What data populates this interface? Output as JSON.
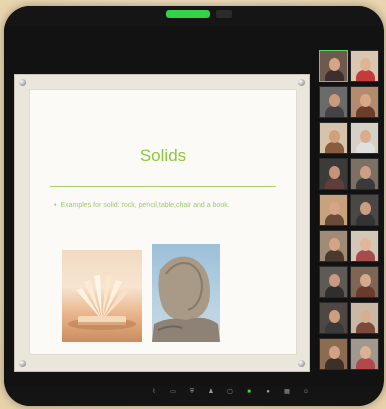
{
  "slide": {
    "title": "Solids",
    "bullet": "Examples for solid: rock, pencil,table,chair and a book."
  },
  "images": {
    "book": "book-photo",
    "rock": "rock-photo"
  },
  "colors": {
    "accent": "#8dc63f",
    "recording": "#33d24b"
  },
  "top_bar": {
    "recording_label": "",
    "view_label": ""
  },
  "participants": [
    {
      "bg": "#6d5a4d",
      "skin": "#d6a487",
      "shirt": "#3e2f2f",
      "active": true
    },
    {
      "bg": "#d9c7b2",
      "skin": "#e0b493",
      "shirt": "#c43b3b",
      "active": false
    },
    {
      "bg": "#6b6b6b",
      "skin": "#c99a7c",
      "shirt": "#444",
      "active": false
    },
    {
      "bg": "#b28c6c",
      "skin": "#d8a889",
      "shirt": "#6b3d2b",
      "active": false
    },
    {
      "bg": "#d7c2ac",
      "skin": "#d1a07f",
      "shirt": "#8b5b3e",
      "active": false
    },
    {
      "bg": "#d6d0c6",
      "skin": "#d8ad8f",
      "shirt": "#e0e0e0",
      "active": false
    },
    {
      "bg": "#3d3b3a",
      "skin": "#c6927a",
      "shirt": "#5f3d3b",
      "active": false
    },
    {
      "bg": "#7c6f64",
      "skin": "#cf9f83",
      "shirt": "#3a3a3a",
      "active": false
    },
    {
      "bg": "#c8a27c",
      "skin": "#d6a487",
      "shirt": "#6a4b3a",
      "active": false
    },
    {
      "bg": "#4a4745",
      "skin": "#cc9d82",
      "shirt": "#333",
      "active": false
    },
    {
      "bg": "#9f8b76",
      "skin": "#d4a486",
      "shirt": "#4a3a2e",
      "active": false
    },
    {
      "bg": "#d3c7b8",
      "skin": "#e1b79a",
      "shirt": "#a74c4c",
      "active": false
    },
    {
      "bg": "#5f5a55",
      "skin": "#c79a81",
      "shirt": "#2f2f2f",
      "active": false
    },
    {
      "bg": "#7f6654",
      "skin": "#d5a98b",
      "shirt": "#6a3a2d",
      "active": false
    },
    {
      "bg": "#4d4844",
      "skin": "#cf9d80",
      "shirt": "#3a3a3a",
      "active": false
    },
    {
      "bg": "#c9b8a6",
      "skin": "#d9ae90",
      "shirt": "#7b4a3a",
      "active": false
    },
    {
      "bg": "#8b6c4f",
      "skin": "#d2a184",
      "shirt": "#3d2f2a",
      "active": false
    },
    {
      "bg": "#a0988e",
      "skin": "#dbb194",
      "shirt": "#b04a4a",
      "active": false
    }
  ],
  "toolbar": [
    {
      "key": "mute",
      "icon": "mic-icon",
      "label": ""
    },
    {
      "key": "video",
      "icon": "video-icon",
      "label": ""
    },
    {
      "key": "security",
      "icon": "shield-icon",
      "label": ""
    },
    {
      "key": "participants",
      "icon": "people-icon",
      "label": ""
    },
    {
      "key": "chat",
      "icon": "chat-icon",
      "label": ""
    },
    {
      "key": "share",
      "icon": "share-screen-icon",
      "label": "",
      "active": true
    },
    {
      "key": "record",
      "icon": "record-icon",
      "label": ""
    },
    {
      "key": "breakout",
      "icon": "breakout-icon",
      "label": ""
    },
    {
      "key": "reactions",
      "icon": "reactions-icon",
      "label": ""
    }
  ]
}
